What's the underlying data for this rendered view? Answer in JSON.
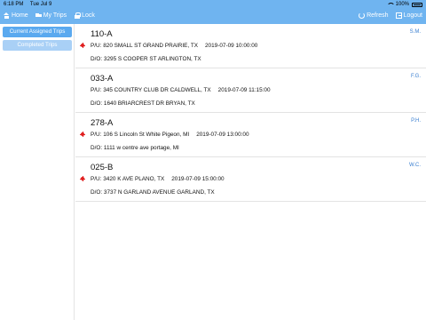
{
  "status": {
    "time": "6:18 PM",
    "date": "Tue Jul 9",
    "battery": "100%"
  },
  "nav": {
    "home": "Home",
    "my_trips": "My Trips",
    "lock": "Lock",
    "refresh": "Refresh",
    "logout": "Logout"
  },
  "sidebar": {
    "current": "Current Assigned Trips",
    "completed": "Completed Trips"
  },
  "trips": [
    {
      "id": "110-A",
      "initials": "S.M.",
      "alert": true,
      "pickup": "P/U: 820 SMALL ST GRAND PRAIRIE, TX",
      "pickup_time": "2019-07-09 10:00:00",
      "dropoff": "D/O: 3295 S COOPER ST ARLINGTON, TX"
    },
    {
      "id": "033-A",
      "initials": "F.G.",
      "alert": false,
      "pickup": "P/U: 345 COUNTRY CLUB DR CALDWELL, TX",
      "pickup_time": "2019-07-09 11:15:00",
      "dropoff": "D/O: 1640 BRIARCREST DR BRYAN, TX"
    },
    {
      "id": "278-A",
      "initials": "P.H.",
      "alert": true,
      "pickup": "P/U: 106 S Lincoln St White Pigeon, MI",
      "pickup_time": "2019-07-09 13:00:00",
      "dropoff": "D/O: 1111 w centre ave portage, MI"
    },
    {
      "id": "025-B",
      "initials": "W.C.",
      "alert": true,
      "pickup": "P/U: 3420 K AVE PLANO, TX",
      "pickup_time": "2019-07-09 15:00:00",
      "dropoff": "D/O: 3737 N GARLAND AVENUE GARLAND, TX"
    }
  ]
}
